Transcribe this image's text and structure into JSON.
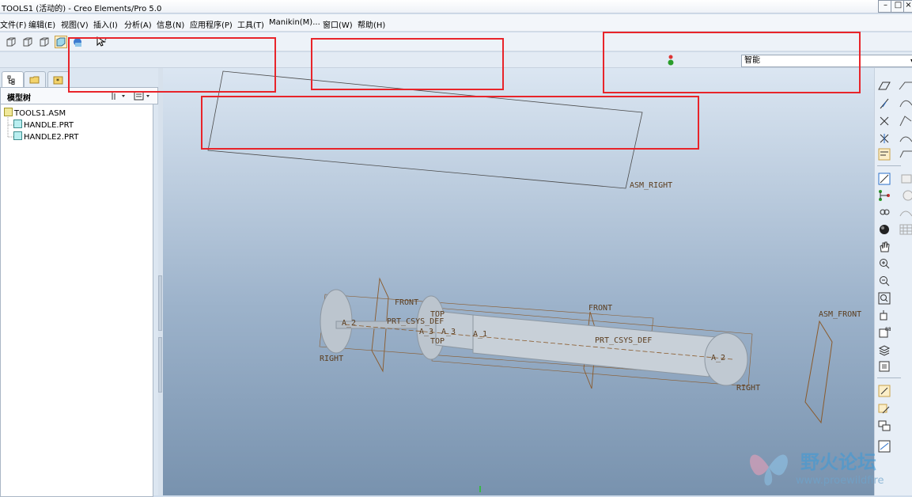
{
  "window": {
    "title": "TOOLS1 (活动的) - Creo Elements/Pro 5.0"
  },
  "menu": [
    "文件(F)",
    "编辑(E)",
    "视图(V)",
    "插入(I)",
    "分析(A)",
    "信息(N)",
    "应用程序(P)",
    "工具(T)",
    "Manikin(M)...",
    "窗口(W)",
    "帮助(H)"
  ],
  "filter": {
    "value": "智能"
  },
  "left_panel": {
    "header": "模型树",
    "tree": [
      {
        "label": "TOOLS1.ASM",
        "type": "assembly"
      },
      {
        "label": "HANDLE.PRT",
        "type": "part"
      },
      {
        "label": "HANDLE2.PRT",
        "type": "part"
      }
    ]
  },
  "viewport_labels": {
    "asm_right": "ASM_RIGHT",
    "asm_front": "ASM_FRONT",
    "front1": "FRONT",
    "front2": "FRONT",
    "top1": "TOP",
    "top2": "TOP",
    "right1": "RIGHT",
    "right2": "RIGHT",
    "csys1": "PRT_CSYS_DEF",
    "csys2": "PRT_CSYS_DEF",
    "axis_a2_left": "A_2",
    "axis_a3": "A_3",
    "axis_a3b": "A_3",
    "axis_a1": "A_1",
    "axis_a2_right": "A_2"
  },
  "watermark": {
    "text": "野火论坛",
    "url": "www.proewildfire"
  },
  "colors": {
    "highlight": "#e8242a",
    "datum": "#8a5a2b",
    "part": "#c8d0d8"
  }
}
